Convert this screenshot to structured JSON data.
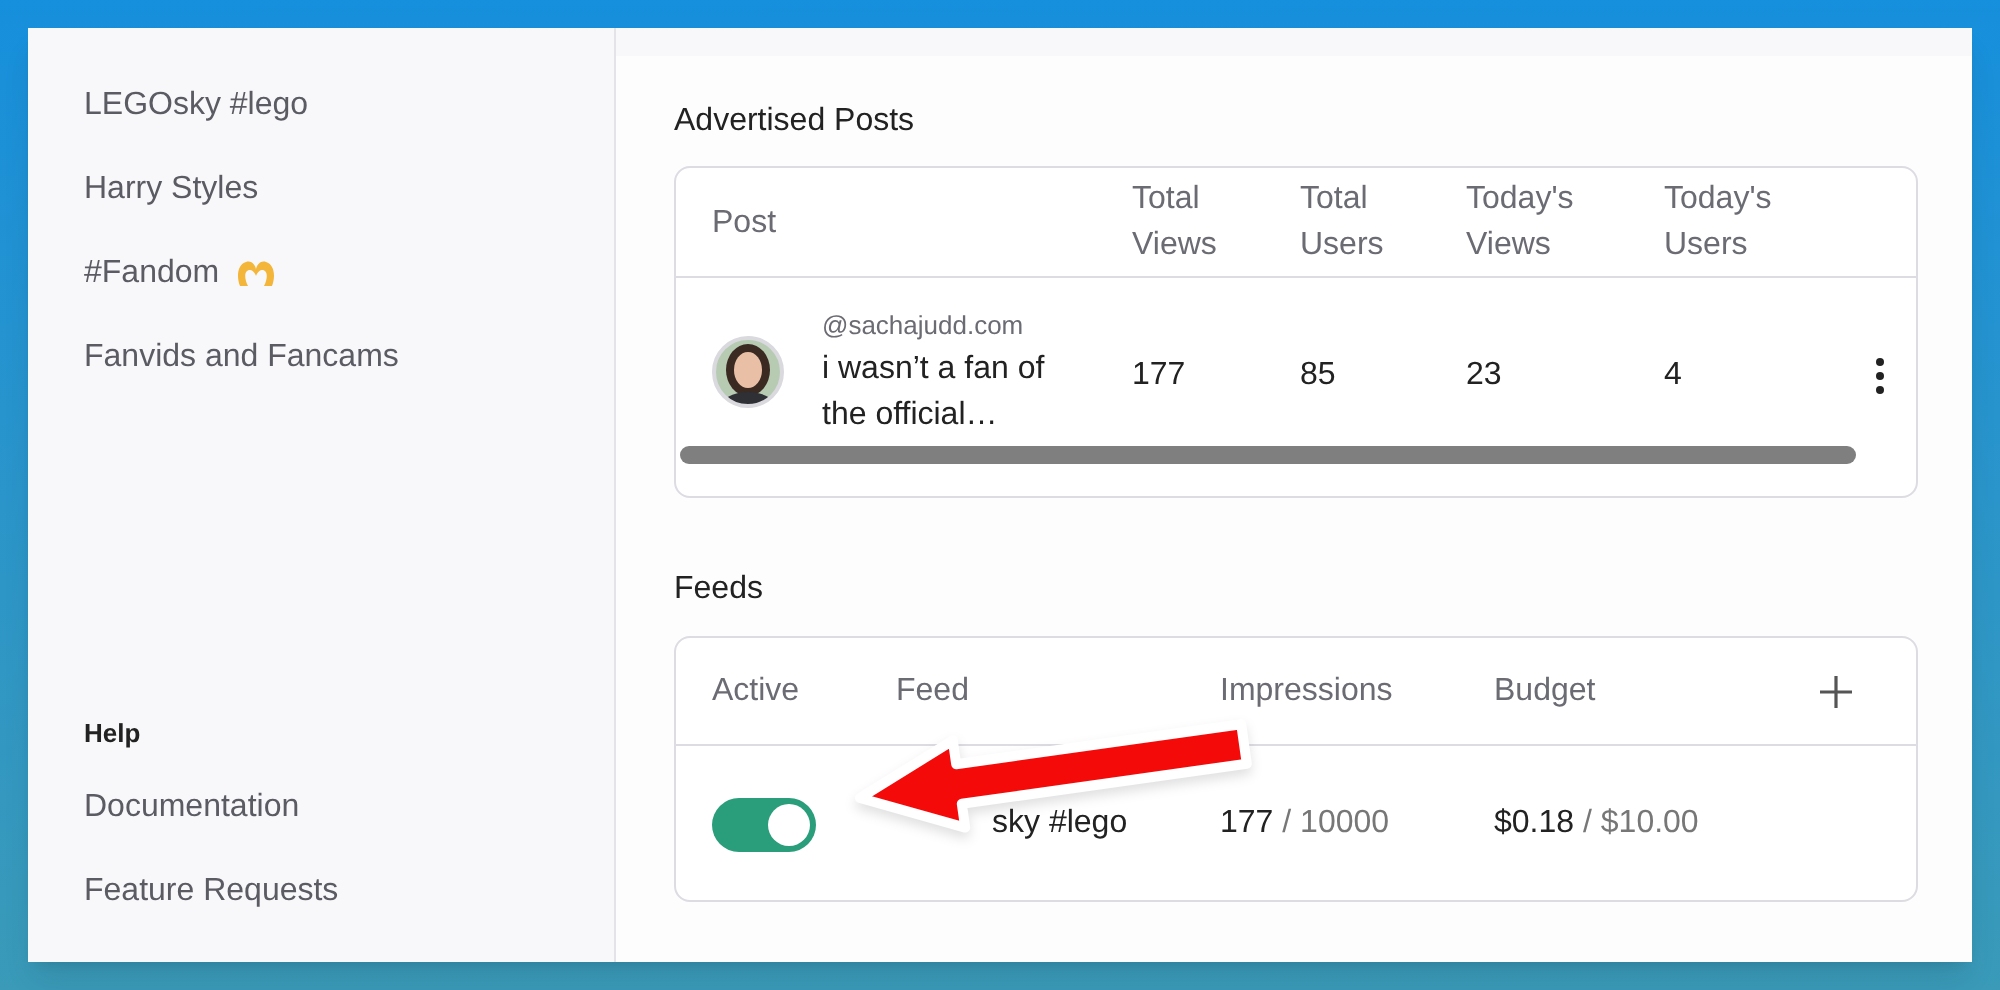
{
  "sidebar": {
    "items": [
      {
        "label": "LEGOsky #lego"
      },
      {
        "label": "Harry Styles"
      },
      {
        "label": "#Fandom",
        "kind": "emoji"
      },
      {
        "label": "Fanvids and Fancams"
      }
    ],
    "help": {
      "title": "Help",
      "items": [
        {
          "label": "Documentation"
        },
        {
          "label": "Feature Requests"
        }
      ]
    }
  },
  "advertised_posts": {
    "title": "Advertised Posts",
    "columns": [
      "Post",
      "Total Views",
      "Total Users",
      "Today's Views",
      "Today's Users"
    ],
    "rows": [
      {
        "cells": [
          {
            "handle": "@sachajudd.com",
            "text": "i wasn’t a fan of the official…"
          },
          "177",
          "85",
          "23",
          "4"
        ]
      }
    ]
  },
  "feeds": {
    "title": "Feeds",
    "columns": [
      "Active",
      "Feed",
      "Impressions",
      "Budget"
    ],
    "rows": [
      {
        "active": true,
        "feed": "sky #lego",
        "impressions": "177",
        "impressions_max": "/ 10000",
        "spent": "$0.18",
        "budget": "/ $10.00"
      }
    ]
  }
}
